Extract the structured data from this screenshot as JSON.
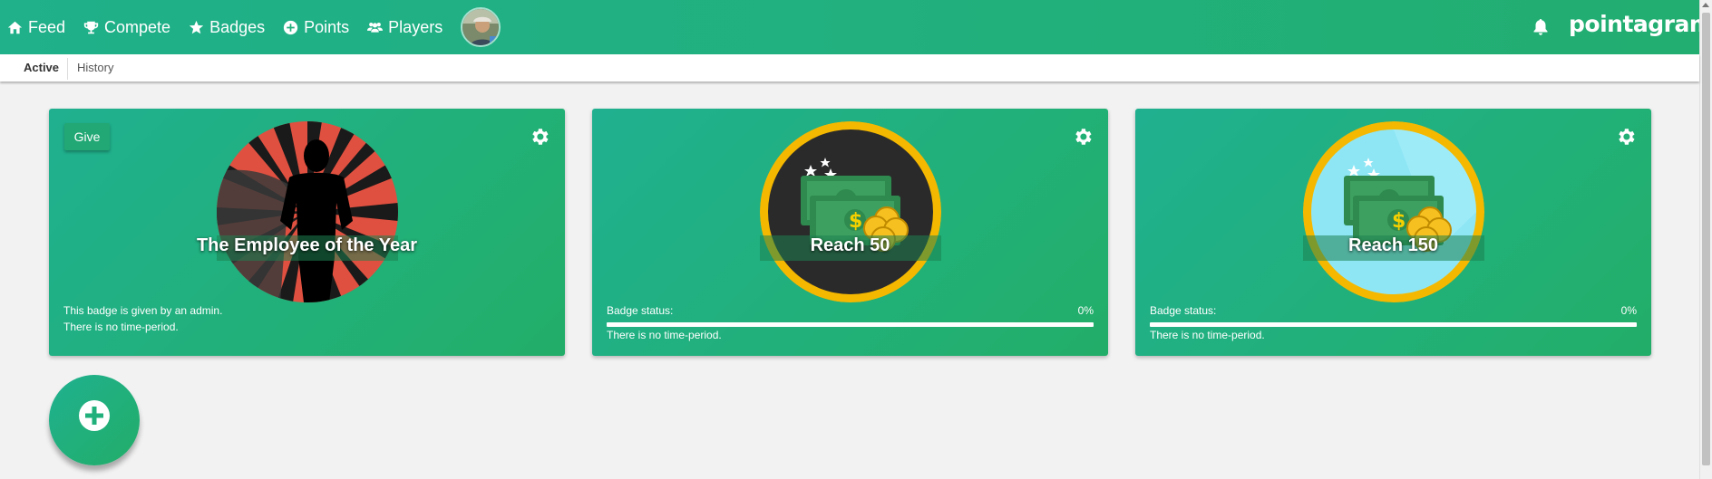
{
  "nav": {
    "items": [
      {
        "label": "Feed",
        "icon": "home-icon"
      },
      {
        "label": "Compete",
        "icon": "trophy-icon"
      },
      {
        "label": "Badges",
        "icon": "star-icon"
      },
      {
        "label": "Points",
        "icon": "plus-circle-icon"
      },
      {
        "label": "Players",
        "icon": "users-icon"
      }
    ],
    "logo": "pointagram",
    "bell_icon": "bell-icon"
  },
  "tabs": {
    "active": "Active",
    "history": "History"
  },
  "cards": [
    {
      "title": "The Employee of the Year",
      "give_label": "Give",
      "info_line1": "This badge is given by an admin.",
      "info_line2": "There is no time-period."
    },
    {
      "title": "Reach 50",
      "status_label": "Badge status:",
      "status_pct": "0%",
      "progress": 0,
      "period": "There is no time-period."
    },
    {
      "title": "Reach 150",
      "status_label": "Badge status:",
      "status_pct": "0%",
      "progress": 0,
      "period": "There is no time-period."
    }
  ],
  "colors": {
    "brand": "#21b07c",
    "page_bg": "#f2f2f2",
    "coin_ring": "#f5b800"
  }
}
